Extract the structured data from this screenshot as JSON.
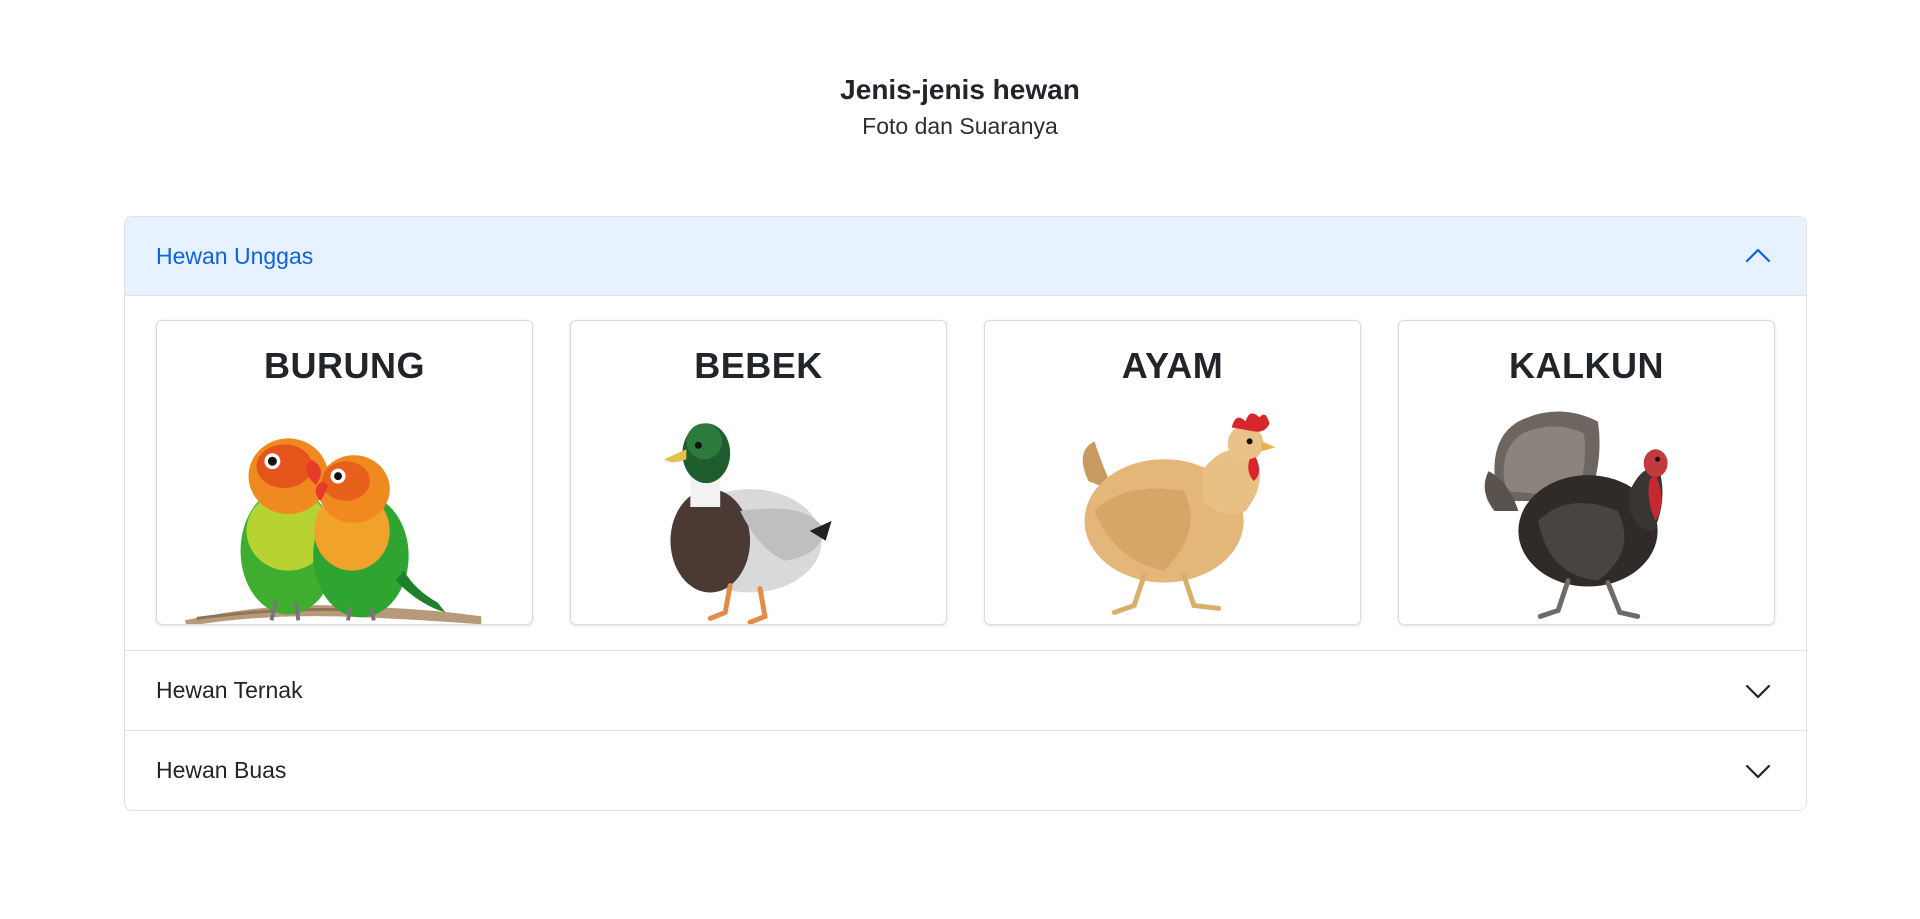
{
  "header": {
    "title": "Jenis-jenis hewan",
    "subtitle": "Foto dan Suaranya"
  },
  "accordion": {
    "sections": [
      {
        "label": "Hewan Unggas",
        "expanded": true,
        "icon": "chevron-up-icon",
        "cards": [
          {
            "label": "BURUNG",
            "image": "lovebird-image"
          },
          {
            "label": "BEBEK",
            "image": "duck-image"
          },
          {
            "label": "AYAM",
            "image": "chicken-image"
          },
          {
            "label": "KALKUN",
            "image": "turkey-image"
          }
        ]
      },
      {
        "label": "Hewan Ternak",
        "expanded": false,
        "icon": "chevron-down-icon"
      },
      {
        "label": "Hewan Buas",
        "expanded": false,
        "icon": "chevron-down-icon"
      }
    ]
  },
  "colors": {
    "accent": "#0c63e4",
    "accent_bg": "#e7f1ff",
    "border": "#dee2e6",
    "text": "#212529"
  }
}
